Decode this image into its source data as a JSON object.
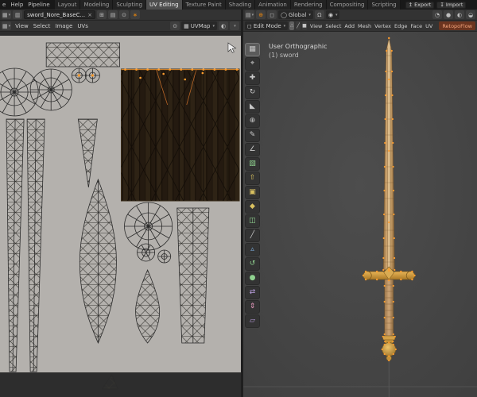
{
  "colors": {
    "topbar-bg": "#191919",
    "header-bg": "#333333",
    "accent-orange": "#e8850d",
    "selection-orange": "#ff9d2e",
    "uv-image-bg": "#b4b1ad",
    "viewport-bg": "#464646",
    "retopoflow-bg": "#6b341f"
  },
  "icons": {
    "caret": "▾",
    "uv_editor_type": "▦",
    "image_browse": "▥",
    "close": "×",
    "new_image": "⊞",
    "open_image": "▤",
    "pin": "⊙",
    "filter": "∗",
    "viewport_editor_type": "▤",
    "active_tool": "⊕",
    "mode_cube": "◻",
    "globe": "◯",
    "magnet": "Ω",
    "proportional": "◉",
    "shading_wireframe": "◔",
    "shading_solid": "●",
    "shading_material": "◐",
    "shading_rendered": "◒",
    "export": "↥",
    "import": "↧",
    "uvmap_grid": "▦"
  },
  "topbar": {
    "menus": [
      "e",
      "Help",
      "Pipeline"
    ],
    "workspace_tabs": [
      "Layout",
      "Modeling",
      "Sculpting",
      "UV Editing",
      "Texture Paint",
      "Shading",
      "Animation",
      "Rendering",
      "Compositing",
      "Scripting"
    ],
    "active_tab": "UV Editing",
    "export_label": "Export",
    "import_label": "Import"
  },
  "uv_editor": {
    "image_name": "sword_Nore_BaseC...",
    "menus": [
      "View",
      "Select",
      "Image",
      "UVs"
    ],
    "uvmap_label": "UVMap"
  },
  "viewport3d": {
    "mode_label": "Edit Mode",
    "select_modes": [
      {
        "name": "vertex",
        "glyph": "∴",
        "active": true
      },
      {
        "name": "edge",
        "glyph": "╱",
        "active": false
      },
      {
        "name": "face",
        "glyph": "■",
        "active": false
      }
    ],
    "menus": [
      "View",
      "Select",
      "Add",
      "Mesh",
      "Vertex",
      "Edge",
      "Face",
      "UV"
    ],
    "orientation_label": "Global",
    "retopoflow_label": "RetopoFlow",
    "overlay_view": "User Orthographic",
    "overlay_object": "(1) sword"
  },
  "toolbar": {
    "tools": [
      {
        "name": "select-box",
        "glyph": "▦",
        "color": "#c8c8c8"
      },
      {
        "name": "cursor",
        "glyph": "⌖",
        "color": "#c8c8c8"
      },
      {
        "name": "move",
        "glyph": "✚",
        "color": "#c8c8c8"
      },
      {
        "name": "rotate",
        "glyph": "↻",
        "color": "#c8c8c8"
      },
      {
        "name": "scale",
        "glyph": "◣",
        "color": "#c8c8c8"
      },
      {
        "name": "transform",
        "glyph": "⊕",
        "color": "#c8c8c8"
      },
      {
        "name": "annotate",
        "glyph": "✎",
        "color": "#c8c8c8"
      },
      {
        "name": "measure",
        "glyph": "∠",
        "color": "#c8c8c8"
      },
      {
        "name": "add-cube",
        "glyph": "▧",
        "color": "#8fd18f"
      },
      {
        "name": "extrude-region",
        "glyph": "⇧",
        "color": "#d9c160"
      },
      {
        "name": "inset-faces",
        "glyph": "▣",
        "color": "#d9c160"
      },
      {
        "name": "bevel",
        "glyph": "◆",
        "color": "#d9c160"
      },
      {
        "name": "loop-cut",
        "glyph": "◫",
        "color": "#8fd18f"
      },
      {
        "name": "knife",
        "glyph": "╱",
        "color": "#c8c8c8"
      },
      {
        "name": "poly-build",
        "glyph": "▵",
        "color": "#7fb2e5"
      },
      {
        "name": "spin",
        "glyph": "↺",
        "color": "#8fd18f"
      },
      {
        "name": "smooth",
        "glyph": "●",
        "color": "#8fd18f"
      },
      {
        "name": "edge-slide",
        "glyph": "⇄",
        "color": "#bb9fe0"
      },
      {
        "name": "shrink-fatten",
        "glyph": "⇕",
        "color": "#e598bc"
      },
      {
        "name": "shear",
        "glyph": "▱",
        "color": "#bb9fe0"
      }
    ]
  }
}
